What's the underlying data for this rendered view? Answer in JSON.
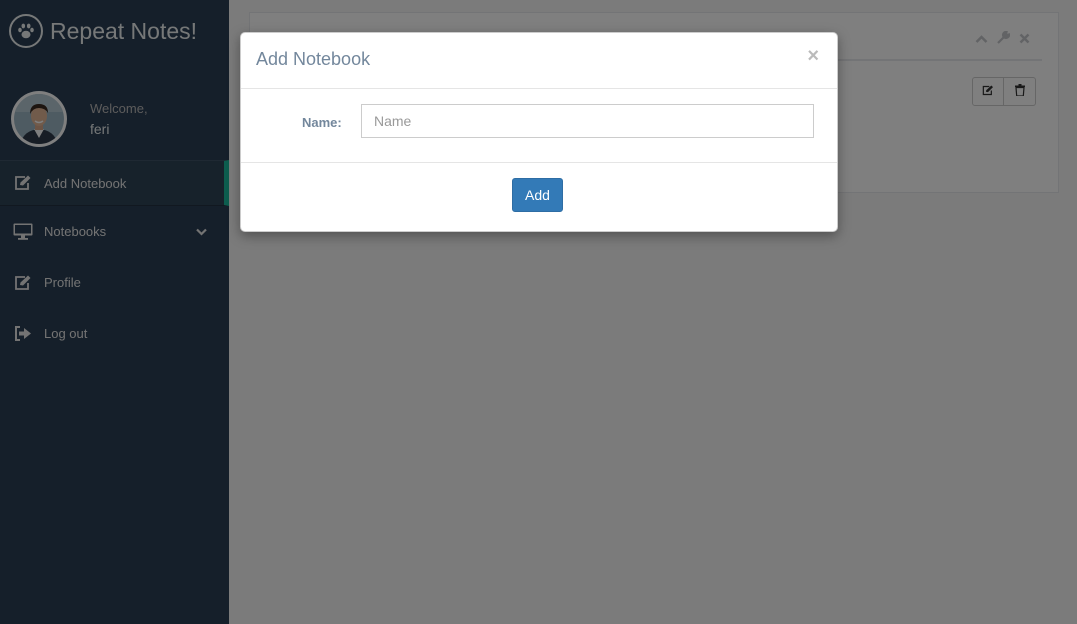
{
  "brand": {
    "title": "Repeat Notes!",
    "icon": "paw-icon"
  },
  "profile": {
    "welcome": "Welcome,",
    "name": "feri"
  },
  "menu": [
    {
      "label": "Add Notebook",
      "icon": "edit-icon",
      "active": true
    },
    {
      "label": "Notebooks",
      "icon": "desktop-icon",
      "has_submenu": true
    },
    {
      "label": "Profile",
      "icon": "edit-icon"
    },
    {
      "label": "Log out",
      "icon": "sign-out-icon"
    }
  ],
  "panel": {
    "tools": [
      "chevron-up-icon",
      "wrench-icon",
      "close-icon"
    ],
    "buttons": [
      "edit-icon",
      "trash-icon"
    ]
  },
  "modal": {
    "title": "Add Notebook",
    "close": "×",
    "name_label": "Name:",
    "name_placeholder": "Name",
    "name_value": "",
    "submit_label": "Add"
  },
  "colors": {
    "sidebar": "#2A3F54",
    "active_accent": "#1ABB9C",
    "primary_button": "#337AB7"
  }
}
